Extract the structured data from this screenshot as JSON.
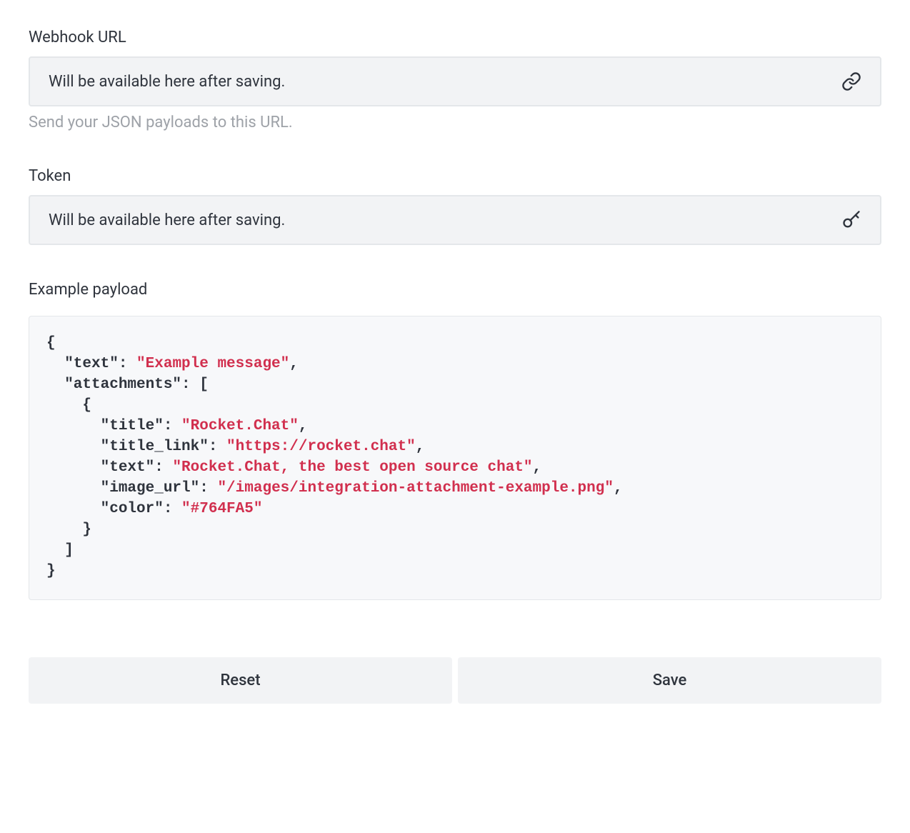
{
  "webhook": {
    "label": "Webhook URL",
    "value": "Will be available here after saving.",
    "help": "Send your JSON payloads to this URL."
  },
  "token": {
    "label": "Token",
    "value": "Will be available here after saving."
  },
  "example": {
    "label": "Example payload",
    "payload": {
      "text": "Example message",
      "attachments": [
        {
          "title": "Rocket.Chat",
          "title_link": "https://rocket.chat",
          "text": "Rocket.Chat, the best open source chat",
          "image_url": "/images/integration-attachment-example.png",
          "color": "#764FA5"
        }
      ]
    }
  },
  "buttons": {
    "reset": "Reset",
    "save": "Save"
  }
}
